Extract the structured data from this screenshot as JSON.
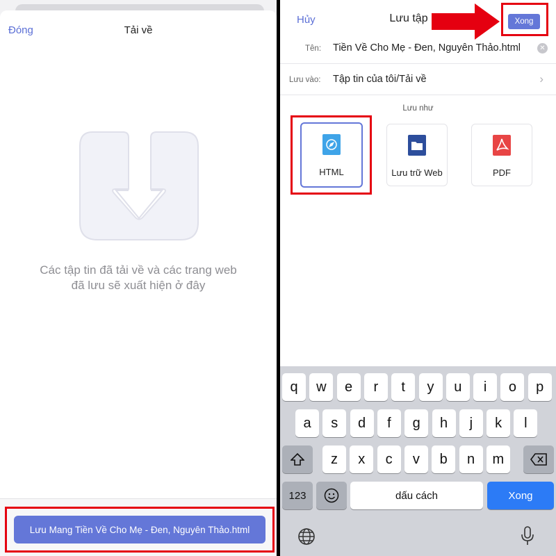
{
  "left": {
    "nav": {
      "close_label": "Đóng",
      "title": "Tải về"
    },
    "empty_state": {
      "icon": "download-icon",
      "line1": "Các tập tin đã tải về và các trang web",
      "line2": "đã lưu sẽ xuất hiện ở đây"
    },
    "save_button_label": "Lưu Mang Tiền Về Cho Mẹ - Đen, Nguyên Thảo.html"
  },
  "right": {
    "nav": {
      "cancel_label": "Hủy",
      "title": "Lưu tập",
      "done_label": "Xong"
    },
    "name_row": {
      "label": "Tên:",
      "value": "Tiền Về Cho Mẹ - Đen, Nguyên Thảo.html"
    },
    "save_to_row": {
      "label": "Lưu vào:",
      "value": "Tập tin của tôi/Tải về"
    },
    "save_as_label": "Lưu như",
    "formats": [
      {
        "label": "HTML",
        "icon": "safari-compass-icon",
        "selected": true
      },
      {
        "label": "Lưu trữ Web",
        "icon": "folder-icon",
        "selected": false
      },
      {
        "label": "PDF",
        "icon": "pdf-icon",
        "selected": false
      }
    ]
  },
  "keyboard": {
    "row1": [
      "q",
      "w",
      "e",
      "r",
      "t",
      "y",
      "u",
      "i",
      "o",
      "p"
    ],
    "row2": [
      "a",
      "s",
      "d",
      "f",
      "g",
      "h",
      "j",
      "k",
      "l"
    ],
    "row3": [
      "z",
      "x",
      "c",
      "v",
      "b",
      "n",
      "m"
    ],
    "numbers_label": "123",
    "space_label": "dấu cách",
    "return_label": "Xong"
  },
  "colors": {
    "accent": "#6477d8",
    "highlight": "#e50010",
    "keyboard_return": "#2c7bf6"
  }
}
